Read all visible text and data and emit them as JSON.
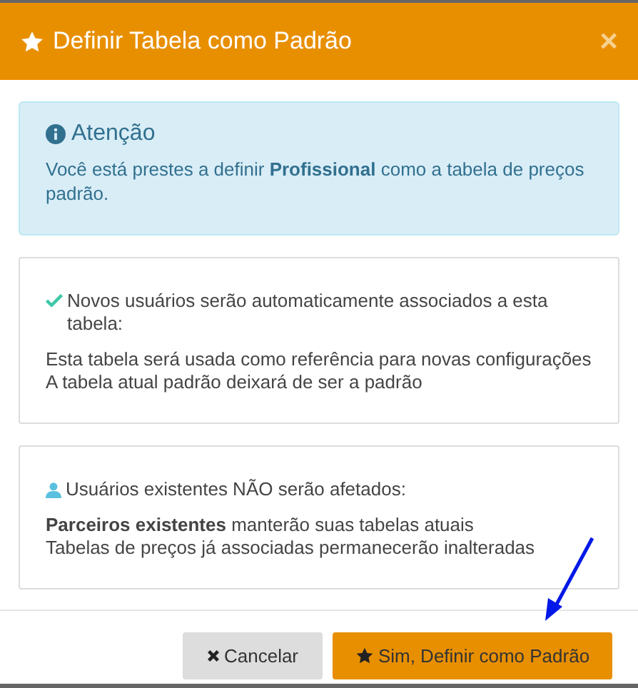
{
  "modal": {
    "title": "Definir Tabela como Padrão",
    "close": "×"
  },
  "alert": {
    "heading": "Atenção",
    "text": "Você está prestes a definir **Profissional** como a tabela de preços padrão."
  },
  "cards": [
    {
      "kind": "check",
      "heading": "Novos usuários serão automaticamente associados a esta tabela:",
      "lines": [
        "Esta tabela será usada como referência para novas configurações",
        "A tabela atual padrão deixará de ser a padrão"
      ]
    },
    {
      "kind": "user",
      "heading": "Usuários existentes NÃO serão afetados:",
      "lines": [
        "**Parceiros existentes** manterão suas tabelas atuais",
        "Tabelas de preços já associadas permanecerão inalteradas"
      ]
    }
  ],
  "buttons": [
    {
      "kind": "cancel",
      "label": "Cancelar"
    },
    {
      "kind": "confirm",
      "label": "Sim, Definir como Padrão"
    }
  ]
}
